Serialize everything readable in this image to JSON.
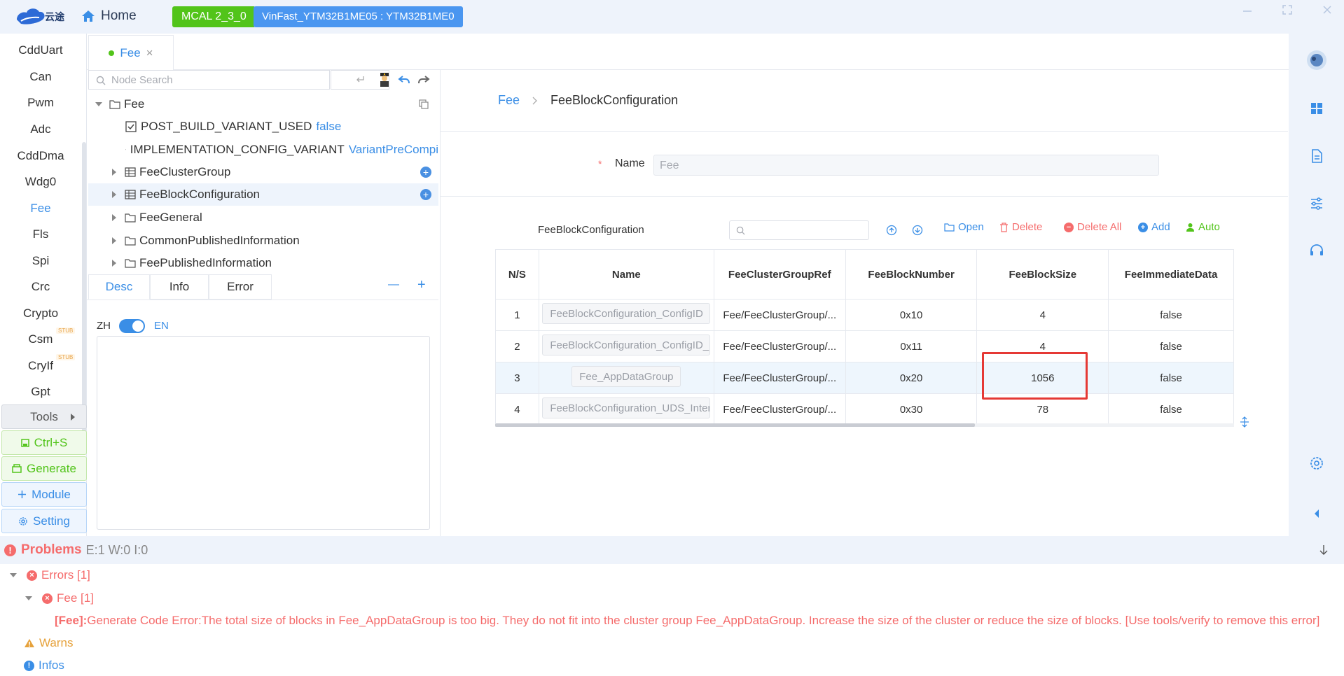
{
  "app": {
    "logo_text": "云途",
    "home_label": "Home",
    "mcal_badge": "MCAL 2_3_0",
    "device_badge": "VinFast_YTM32B1ME05 : YTM32B1ME0"
  },
  "leftnav": {
    "items": [
      {
        "label": "CddUart"
      },
      {
        "label": "Can"
      },
      {
        "label": "Pwm"
      },
      {
        "label": "Adc"
      },
      {
        "label": "CddDma"
      },
      {
        "label": "Wdg0"
      },
      {
        "label": "Fee"
      },
      {
        "label": "Fls"
      },
      {
        "label": "Spi"
      },
      {
        "label": "Crc"
      },
      {
        "label": "Crypto"
      },
      {
        "label": "Csm",
        "stub": "STUB"
      },
      {
        "label": "CryIf",
        "stub": "STUB"
      },
      {
        "label": "Gpt"
      }
    ],
    "tools_label": "Tools",
    "save_label": "Ctrl+S",
    "generate_label": "Generate",
    "module_label": "Module",
    "setting_label": "Setting"
  },
  "tabs": [
    {
      "label": "Fee",
      "close": "×"
    }
  ],
  "tree": {
    "search_placeholder": "Node Search",
    "nodes": [
      {
        "label": "Fee"
      },
      {
        "label": "POST_BUILD_VARIANT_USED",
        "value": "false"
      },
      {
        "label": "IMPLEMENTATION_CONFIG_VARIANT",
        "value": "VariantPreCompi"
      },
      {
        "label": "FeeClusterGroup"
      },
      {
        "label": "FeeBlockConfiguration"
      },
      {
        "label": "FeeGeneral"
      },
      {
        "label": "CommonPublishedInformation"
      },
      {
        "label": "FeePublishedInformation"
      }
    ]
  },
  "desc": {
    "tabs": [
      "Desc",
      "Info",
      "Error"
    ],
    "minus": "—",
    "plus": "+",
    "lang_zh": "ZH",
    "lang_en": "EN"
  },
  "main": {
    "breadcrumb_root": "Fee",
    "breadcrumb_current": "FeeBlockConfiguration",
    "name_required": "*",
    "name_label": "Name",
    "name_value": "Fee",
    "section_title": "FeeBlockConfiguration",
    "actions": {
      "open": "Open",
      "delete": "Delete",
      "delete_all": "Delete All",
      "add": "Add",
      "auto": "Auto"
    },
    "table": {
      "columns": [
        "N/S",
        "Name",
        "FeeClusterGroupRef",
        "FeeBlockNumber",
        "FeeBlockSize",
        "FeeImmediateData"
      ],
      "rows": [
        {
          "ns": "1",
          "name": "FeeBlockConfiguration_ConfigID",
          "ref": "Fee/FeeClusterGroup/...",
          "number": "0x10",
          "size": "4",
          "immediate": "false"
        },
        {
          "ns": "2",
          "name": "FeeBlockConfiguration_ConfigID_I",
          "ref": "Fee/FeeClusterGroup/...",
          "number": "0x11",
          "size": "4",
          "immediate": "false"
        },
        {
          "ns": "3",
          "name": "Fee_AppDataGroup",
          "ref": "Fee/FeeClusterGroup/...",
          "number": "0x20",
          "size": "1056",
          "immediate": "false"
        },
        {
          "ns": "4",
          "name": "FeeBlockConfiguration_UDS_Inter",
          "ref": "Fee/FeeClusterGroup/...",
          "number": "0x30",
          "size": "78",
          "immediate": "false"
        }
      ]
    }
  },
  "problems": {
    "title": "Problems",
    "counts": "E:1 W:0 I:0",
    "errors_label": "Errors [1]",
    "fee_label": "Fee [1]",
    "error_prefix": "[Fee]:",
    "error_message": " Generate Code Error:The total size of blocks in Fee_AppDataGroup is too big. They do not fit into the cluster group Fee_AppDataGroup. Increase the size of the cluster or reduce the size of blocks. [Use tools/verify to remove this error]",
    "warns_label": "Warns",
    "infos_label": "Infos"
  },
  "colors": {
    "accent": "#3a8ee6",
    "green": "#52c41a",
    "error": "#f56c6c",
    "warn": "#e6a23c",
    "highlight_box": "#e53935"
  }
}
